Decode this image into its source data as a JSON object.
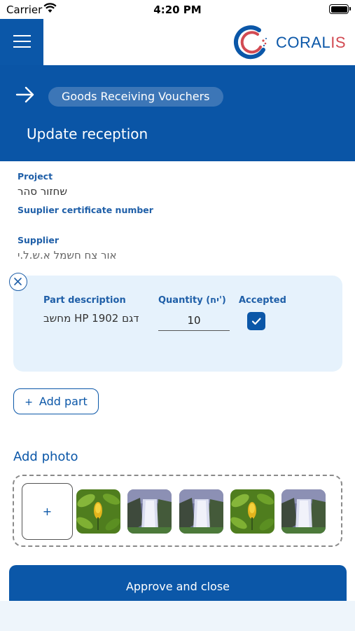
{
  "status_bar": {
    "carrier": "Carrier",
    "time": "4:20 PM"
  },
  "brand": {
    "name_main": "CORAL",
    "name_accent": "IS",
    "primary_color": "#0b57a8",
    "accent_color": "#d24a52"
  },
  "header": {
    "breadcrumb": "Goods Receiving Vouchers",
    "title": "Update reception"
  },
  "fields": {
    "project_label": "Project",
    "project_value": "שחזור סהר",
    "certificate_label": "Suuplier certificate number",
    "certificate_value": "",
    "supplier_label": "Supplier",
    "supplier_value": "אור צח חשמל א.ש.ל.י"
  },
  "part": {
    "description_label": "Part description",
    "quantity_label": "Quantity (יח')",
    "accepted_label": "Accepted",
    "description": "מחשב HP דגם 1902",
    "quantity": "10",
    "accepted": true
  },
  "actions": {
    "add_part": "Add part",
    "add_part_icon": "+",
    "add_photo_title": "Add photo",
    "add_photo_icon": "+",
    "approve": "Approve and close"
  },
  "photos": [
    "flower-photo",
    "waterfall-photo",
    "waterfall-photo",
    "flower-photo",
    "waterfall-photo"
  ]
}
